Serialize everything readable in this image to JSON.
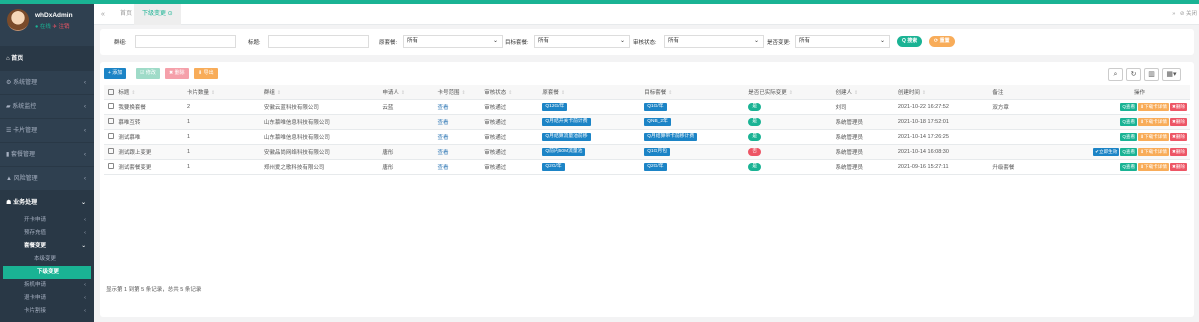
{
  "user": {
    "name": "whDxAdmin",
    "online": "● 在线",
    "logout": "✈ 注销"
  },
  "sidebar": {
    "home": "首页",
    "items": [
      {
        "label": "系统管理",
        "icon": "gear-icon",
        "glyph": "⚙"
      },
      {
        "label": "系统监控",
        "icon": "video-icon",
        "glyph": "▰"
      },
      {
        "label": "卡片管理",
        "icon": "list-icon",
        "glyph": "☰"
      },
      {
        "label": "套餐管理",
        "icon": "chart-icon",
        "glyph": "▮"
      },
      {
        "label": "风险管理",
        "icon": "warning-icon",
        "glyph": "▲"
      }
    ],
    "active_group": {
      "label": "业务处理",
      "icon": "users-icon",
      "glyph": "☗"
    },
    "subs": [
      {
        "label": "开卡申请",
        "type": "sub"
      },
      {
        "label": "预存充值",
        "type": "sub"
      },
      {
        "label": "套餐变更",
        "type": "group"
      },
      {
        "label": "本级变更",
        "type": "sub3"
      },
      {
        "label": "下级变更",
        "type": "sel"
      },
      {
        "label": "拆机申请",
        "type": "sub"
      },
      {
        "label": "退卡申请",
        "type": "sub"
      },
      {
        "label": "卡片割接",
        "type": "sub"
      }
    ]
  },
  "tabbar": {
    "back": "«",
    "home_tab": "首页",
    "active_tab": "下级变更 ⊙",
    "forward": "»",
    "close": "⊘ 关闭"
  },
  "search": {
    "group_label": "群组:",
    "title_label": "标题:",
    "source_label": "原套餐:",
    "source_value": "所有",
    "target_label": "目标套餐:",
    "target_value": "所有",
    "status_label": "审核状态:",
    "status_value": "所有",
    "change_label": "是否变更:",
    "change_value": "所有",
    "search_btn": "Q 搜索",
    "reset_btn": "⟳ 重置"
  },
  "toolbar": {
    "add": "+ 添加",
    "edit": "☑ 修改",
    "delete": "✖ 删除",
    "export": "⬇ 导出"
  },
  "table": {
    "headers": [
      "标题",
      "卡片数量",
      "群组",
      "申请人",
      "卡号范围",
      "审核状态",
      "原套餐",
      "目标套餐",
      "是否已实际变更",
      "创建人",
      "创建时间",
      "备注",
      "操作"
    ],
    "rows": [
      {
        "title": "我要换套餐",
        "count": "2",
        "group": "安徽云蓝科技有限公司",
        "applicant": "云蓝",
        "range": "查看",
        "status": "审核通过",
        "src": "Q12G/年",
        "tgt": "Q1G/年",
        "changed": "是",
        "creator": "刘司",
        "time": "2021-10-22 16:27:52",
        "remark": "双方章",
        "ops": [
          "Q查看",
          "⬇下载卡详情",
          "✖删除"
        ]
      },
      {
        "title": "慕唯互转",
        "count": "1",
        "group": "山东慕唯信息科技有限公司",
        "applicant": "",
        "range": "查看",
        "status": "审核通过",
        "src": "Q月结开关卡前计费",
        "tgt": "QNB_2年",
        "changed": "是",
        "creator": "系统管理员",
        "time": "2021-10-18 17:52:01",
        "remark": "",
        "ops": [
          "Q查看",
          "⬇下载卡详情",
          "✖删除"
        ]
      },
      {
        "title": "测试慕唯",
        "count": "1",
        "group": "山东慕唯信息科技有限公司",
        "applicant": "",
        "range": "查看",
        "status": "审核通过",
        "src": "Q月结算流量池前移",
        "tgt": "Q月结算带卡前移计费",
        "changed": "是",
        "creator": "系统管理员",
        "time": "2021-10-14 17:26:25",
        "remark": "",
        "ops": [
          "Q查看",
          "⬇下载卡详情",
          "✖删除"
        ]
      },
      {
        "title": "测试跟上变更",
        "count": "1",
        "group": "安徽品尚网络科技有限公司",
        "applicant": "唐彤",
        "range": "查看",
        "status": "审核通过",
        "src": "Q前内50M流量池",
        "tgt": "Q1G月包",
        "changed": "否",
        "creator": "系统管理员",
        "time": "2021-10-14 16:08:30",
        "remark": "",
        "ops": [
          "✔立即生效",
          "Q查看",
          "⬇下载卡详情",
          "✖删除"
        ]
      },
      {
        "title": "测试套餐变更",
        "count": "1",
        "group": "郑州爱之歌科技有限公司",
        "applicant": "唐彤",
        "range": "查看",
        "status": "审核通过",
        "src": "Q2G/年",
        "tgt": "Q2G/年",
        "changed": "是",
        "creator": "系统管理员",
        "time": "2021-09-16 15:27:11",
        "remark": "升级套餐",
        "ops": [
          "Q查看",
          "⬇下载卡详情",
          "✖删除"
        ]
      }
    ]
  },
  "footer": "显示第 1 到第 5 条记录，总共 5 条记录",
  "colors": {
    "green": "#1ab394",
    "sidebar": "#2f4050",
    "blue": "#1c84c6",
    "red": "#ed5565",
    "orange": "#f8ac59"
  }
}
